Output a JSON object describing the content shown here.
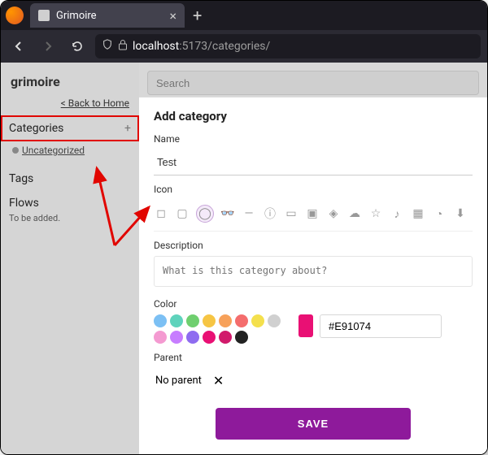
{
  "browser": {
    "tab_title": "Grimoire",
    "url_host": "localhost",
    "url_port": ":5173",
    "url_path": "/categories/"
  },
  "sidebar": {
    "brand": "grimoire",
    "back_link": "< Back to Home",
    "categories_label": "Categories",
    "categories_add_glyph": "+",
    "uncategorized_label": "Uncategorized",
    "tags_label": "Tags",
    "flows_label": "Flows",
    "flows_sub": "To be added."
  },
  "search": {
    "placeholder": "Search"
  },
  "panel": {
    "title": "Add category",
    "name_label": "Name",
    "name_value": "Test",
    "icon_label": "Icon",
    "icons": [
      "bookmark",
      "clipboard",
      "circle",
      "glasses",
      "minus",
      "info",
      "book",
      "folder",
      "tag",
      "cloud",
      "star",
      "music",
      "grid",
      "bell",
      "download",
      "quote",
      "quote2",
      "heart",
      "N"
    ],
    "icon_selected_index": 2,
    "description_label": "Description",
    "description_placeholder": "What is this category about?",
    "color_label": "Color",
    "swatches_row1": [
      "#7cc0f4",
      "#5fd3bc",
      "#6fcf6f",
      "#f6c544",
      "#f7a15a",
      "#f46d6d",
      "#f4e04d",
      "#d0d0d0"
    ],
    "swatches_row2": [
      "#f49ad1",
      "#c77dff",
      "#8e6cf0",
      "#e91074",
      "#d11a6b",
      "#222222"
    ],
    "color_value": "#E91074",
    "parent_label": "Parent",
    "parent_value": "No parent",
    "parent_clear_glyph": "✕",
    "save_label": "SAVE"
  }
}
